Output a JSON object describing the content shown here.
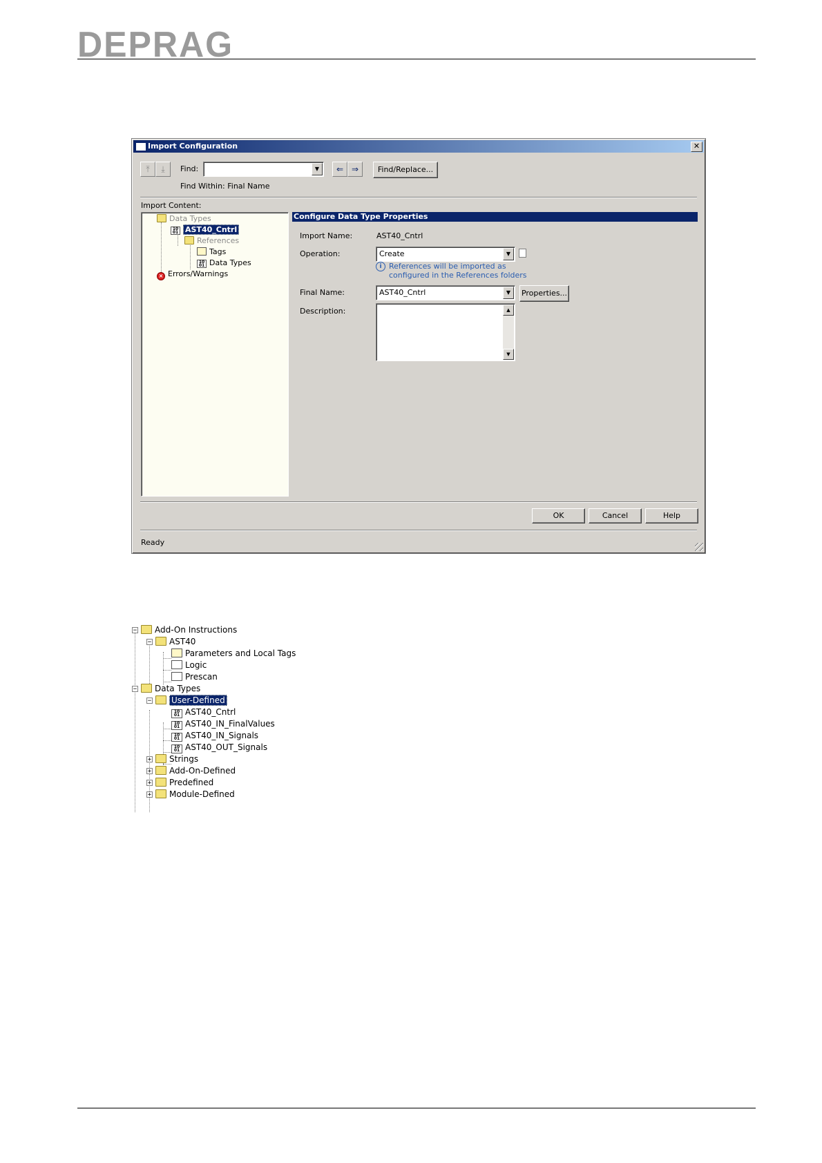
{
  "header": {
    "logo_text": "DEPRAG"
  },
  "dialog": {
    "title": "Import Configuration",
    "close_label": "✕",
    "find_label": "Find:",
    "find_value": "",
    "find_within": "Find Within: Final Name",
    "find_replace_button": "Find/Replace...",
    "import_content_label": "Import Content:",
    "tree": [
      {
        "label": "Data Types",
        "icon": "folder-datatypes-icon",
        "dimmed": true
      },
      {
        "label": "AST40_Cntrl",
        "icon": "datatype-icon",
        "selected": true
      },
      {
        "label": "References",
        "icon": "folder-icon",
        "dimmed": true
      },
      {
        "label": "Tags",
        "icon": "tags-icon"
      },
      {
        "label": "Data Types",
        "icon": "datatype-icon"
      },
      {
        "label": "Errors/Warnings",
        "icon": "error-icon"
      }
    ],
    "panel_title": "Configure Data Type Properties",
    "import_name_label": "Import Name:",
    "import_name_value": "AST40_Cntrl",
    "operation_label": "Operation:",
    "operation_value": "Create",
    "info_line1": "References will be imported as",
    "info_line2": "configured in the References folders",
    "final_name_label": "Final Name:",
    "final_name_value": "AST40_Cntrl",
    "properties_button": "Properties...",
    "description_label": "Description:",
    "description_value": "",
    "ok_button": "OK",
    "cancel_button": "Cancel",
    "help_button": "Help",
    "status": "Ready"
  },
  "project_tree": [
    {
      "label": "Add-On Instructions",
      "icon": "folder-icon",
      "expander": "−"
    },
    {
      "label": "AST40",
      "icon": "aoi-folder-icon",
      "expander": "−"
    },
    {
      "label": "Parameters and Local Tags",
      "icon": "tags-icon"
    },
    {
      "label": "Logic",
      "icon": "logic-icon"
    },
    {
      "label": "Prescan",
      "icon": "prescan-icon"
    },
    {
      "label": "Data Types",
      "icon": "folder-icon",
      "expander": "−"
    },
    {
      "label": "User-Defined",
      "icon": "folder-datatypes-icon",
      "expander": "−",
      "selected": true
    },
    {
      "label": "AST40_Cntrl",
      "icon": "datatype-icon"
    },
    {
      "label": "AST40_IN_FinalValues",
      "icon": "datatype-icon"
    },
    {
      "label": "AST40_IN_Signals",
      "icon": "datatype-icon"
    },
    {
      "label": "AST40_OUT_Signals",
      "icon": "datatype-icon"
    },
    {
      "label": "Strings",
      "icon": "folder-datatypes-icon",
      "expander": "+"
    },
    {
      "label": "Add-On-Defined",
      "icon": "folder-datatypes-icon",
      "expander": "+"
    },
    {
      "label": "Predefined",
      "icon": "folder-datatypes-icon",
      "expander": "+"
    },
    {
      "label": "Module-Defined",
      "icon": "folder-datatypes-icon",
      "expander": "+"
    }
  ],
  "colors": {
    "dialog_face": "#d6d3ce",
    "selection": "#0a246a",
    "info_text": "#2a5db0"
  }
}
